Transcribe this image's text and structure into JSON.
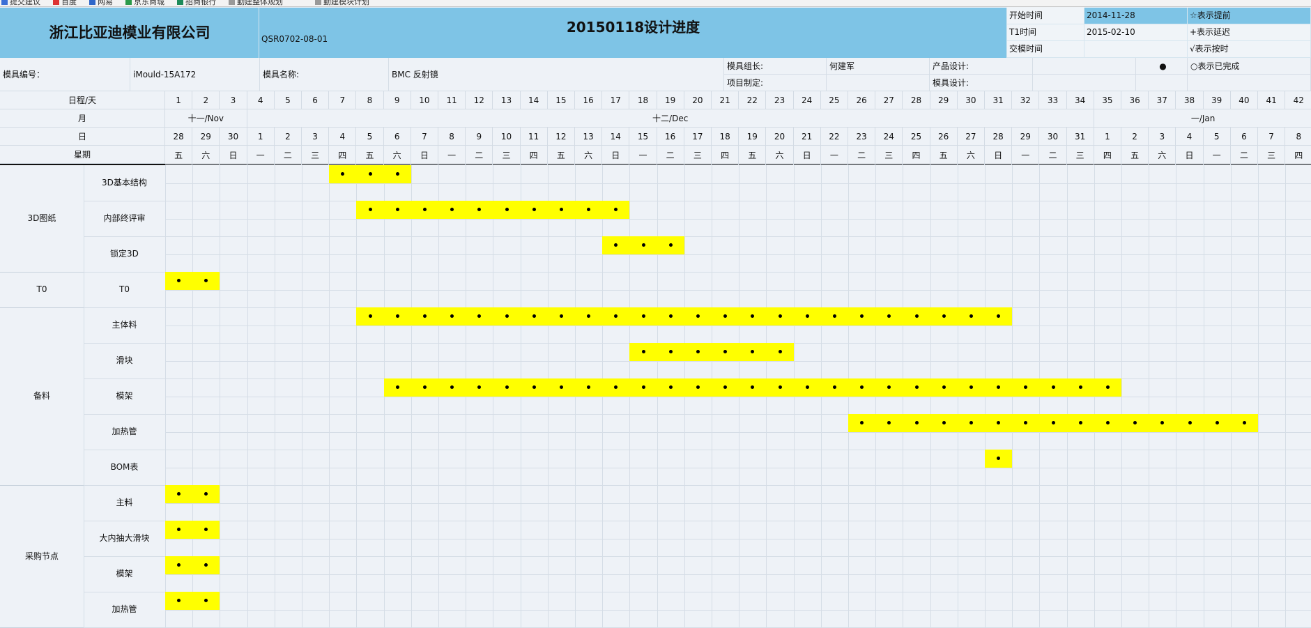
{
  "browser": {
    "bookmarks": [
      "提交建议",
      "百度",
      "网易",
      "京东商城",
      "招商银行",
      "勤建整体规划",
      "勤建模块计划"
    ]
  },
  "header": {
    "company": "浙江比亚迪模业有限公司",
    "title": "20150118设计进度",
    "doc_code": "QSR0702-08-01",
    "right_labels": [
      "开始时间",
      "T1时间",
      "交模时间"
    ],
    "right_values": [
      "2014-11-28",
      "2015-02-10",
      ""
    ],
    "legend": [
      "☆表示提前",
      "+表示延迟",
      "√表示按时",
      "○表示已完成"
    ],
    "legend_dot": "●"
  },
  "info": {
    "mold_no_label": "模具编号：",
    "mold_no_value": "iMould-15A172",
    "mold_name_label": "模具名称:",
    "mold_name_value": "BMC 反射镜",
    "leader_label": "模具组长:",
    "leader_value": "何建军",
    "project_label": "项目制定:",
    "project_value": "",
    "product_label": "产品设计:",
    "product_value": "",
    "mold_design_label": "模具设计:",
    "mold_design_value": ""
  },
  "schedule": {
    "row_labels": [
      "日程/天",
      "月",
      "日",
      "星期"
    ],
    "day_index": [
      "1",
      "2",
      "3",
      "4",
      "5",
      "6",
      "7",
      "8",
      "9",
      "10",
      "11",
      "12",
      "13",
      "14",
      "15",
      "16",
      "17",
      "18",
      "19",
      "20",
      "21",
      "22",
      "23",
      "24",
      "25",
      "26",
      "27",
      "28",
      "29",
      "30",
      "31",
      "32",
      "33",
      "34",
      "35",
      "36",
      "37",
      "38",
      "39",
      "40",
      "41",
      "42"
    ],
    "months": [
      {
        "label": "十一/Nov",
        "start": 0,
        "span": 3
      },
      {
        "label": "十二/Dec",
        "start": 3,
        "span": 31
      },
      {
        "label": "一/Jan",
        "start": 34,
        "span": 8
      }
    ],
    "dates": [
      "28",
      "29",
      "30",
      "1",
      "2",
      "3",
      "4",
      "5",
      "6",
      "7",
      "8",
      "9",
      "10",
      "11",
      "12",
      "13",
      "14",
      "15",
      "16",
      "17",
      "18",
      "19",
      "20",
      "21",
      "22",
      "23",
      "24",
      "25",
      "26",
      "27",
      "28",
      "29",
      "30",
      "31",
      "1",
      "2",
      "3",
      "4",
      "5",
      "6",
      "7",
      "8"
    ],
    "weekdays": [
      "五",
      "六",
      "日",
      "一",
      "二",
      "三",
      "四",
      "五",
      "六",
      "日",
      "一",
      "二",
      "三",
      "四",
      "五",
      "六",
      "日",
      "一",
      "二",
      "三",
      "四",
      "五",
      "六",
      "日",
      "一",
      "二",
      "三",
      "四",
      "五",
      "六",
      "日",
      "一",
      "二",
      "三",
      "四",
      "五",
      "六",
      "日",
      "一",
      "二",
      "三",
      "四"
    ],
    "groups": [
      {
        "name": "3D图纸",
        "tasks": [
          {
            "name": "3D基本结构",
            "start": 6,
            "end": 8
          },
          {
            "name": "内部终评审",
            "start": 7,
            "end": 16
          },
          {
            "name": "锁定3D",
            "start": 16,
            "end": 18
          }
        ]
      },
      {
        "name": "T0",
        "tasks": [
          {
            "name": "T0",
            "start": 0,
            "end": 1
          }
        ]
      },
      {
        "name": "备料",
        "tasks": [
          {
            "name": "主体料",
            "start": 7,
            "end": 30
          },
          {
            "name": "滑块",
            "start": 17,
            "end": 22
          },
          {
            "name": "模架",
            "start": 8,
            "end": 34
          },
          {
            "name": "加热管",
            "start": 25,
            "end": 39
          },
          {
            "name": "BOM表",
            "start": 30,
            "end": 30
          }
        ]
      },
      {
        "name": "采购节点",
        "tasks": [
          {
            "name": "主料",
            "start": 0,
            "end": 1
          },
          {
            "name": "大内抽大滑块",
            "start": 0,
            "end": 1
          },
          {
            "name": "模架",
            "start": 0,
            "end": 1
          },
          {
            "name": "加热管",
            "start": 0,
            "end": 1
          }
        ]
      }
    ]
  },
  "colors": {
    "header_blue": "#7ec4e6",
    "bar_yellow": "#ffff00",
    "background": "#eef2f7"
  }
}
